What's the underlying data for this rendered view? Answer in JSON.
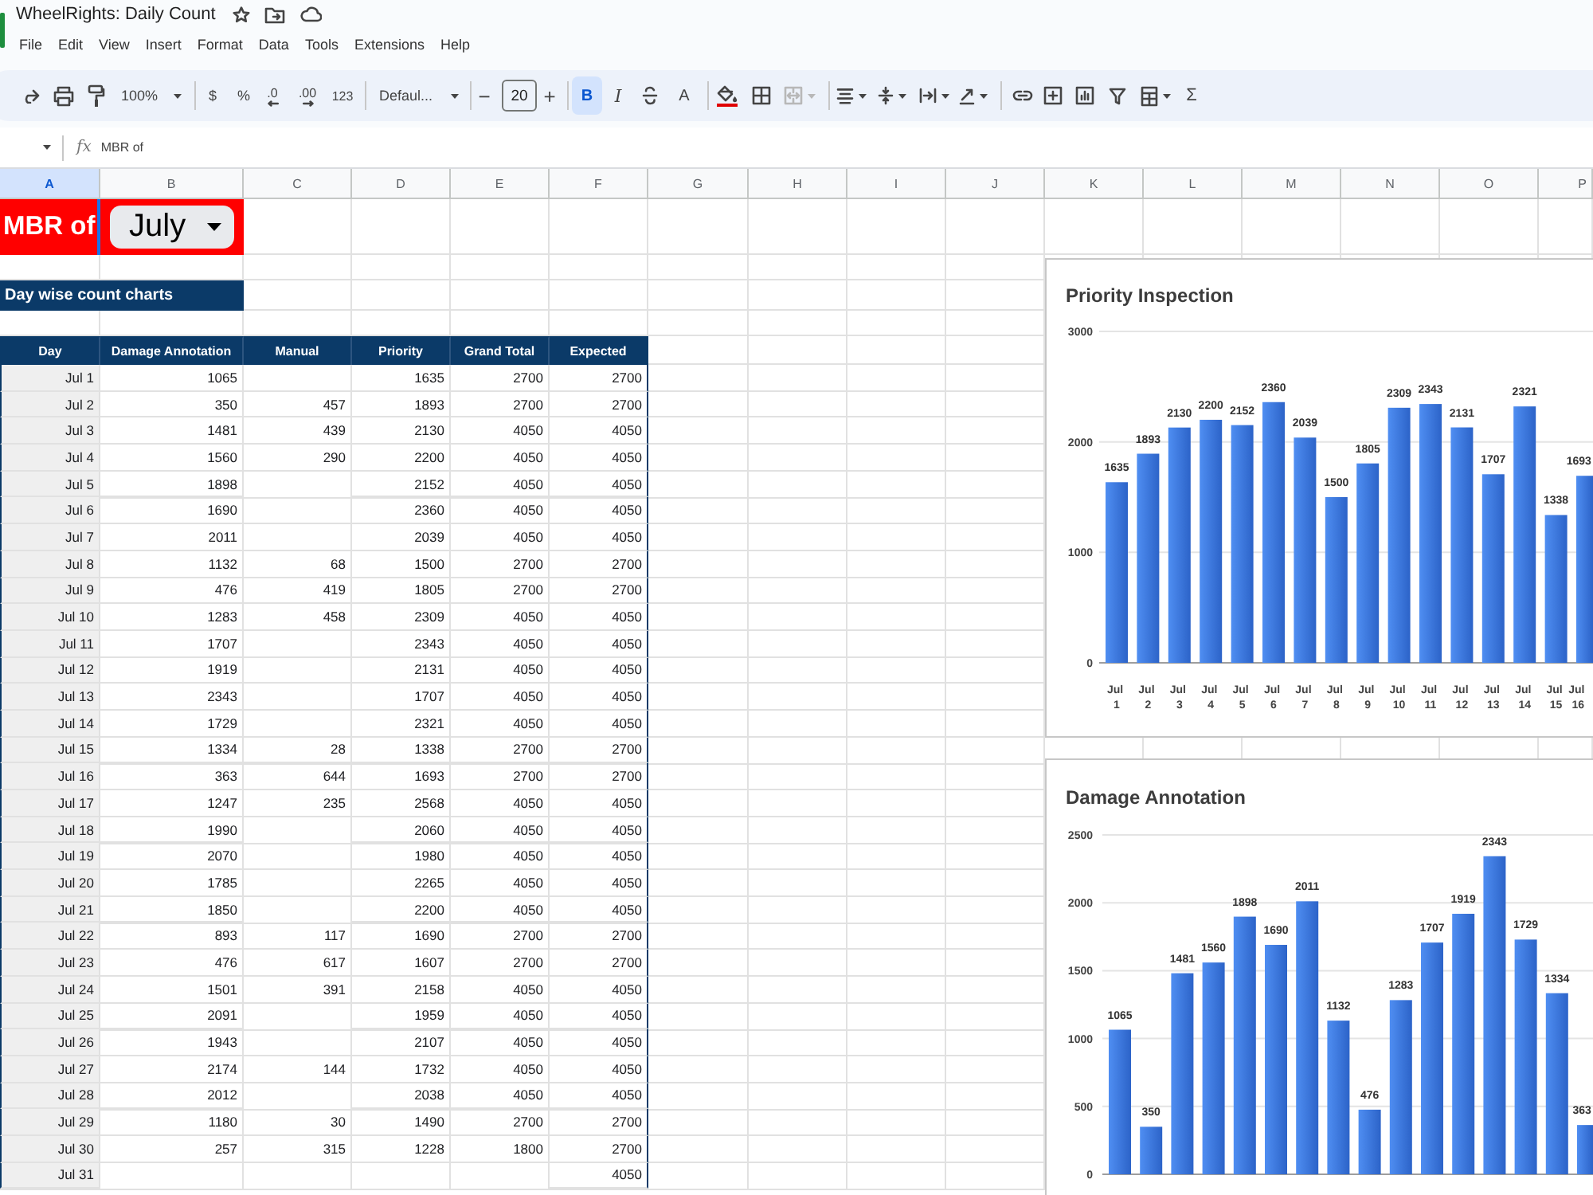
{
  "window": {
    "title": "WheelRights: Daily Count"
  },
  "menu": [
    "File",
    "Edit",
    "View",
    "Insert",
    "Format",
    "Data",
    "Tools",
    "Extensions",
    "Help"
  ],
  "toolbar": {
    "zoom": "100%",
    "currency": "$",
    "percent": "%",
    "decrease_decimal": ".0",
    "increase_decimal": ".00",
    "number_format": "123",
    "font": "Defaul...",
    "size_down": "−",
    "font_size": "20",
    "size_up": "+",
    "bold": {
      "label": "B",
      "on": true
    },
    "italic": "I",
    "text_color": "A",
    "functions": "Σ"
  },
  "formula_bar": {
    "fx": "fx",
    "value": "MBR of"
  },
  "column_headers": [
    {
      "label": "A",
      "selected": true
    },
    {
      "label": "B",
      "selected": false
    },
    {
      "label": "C",
      "selected": false
    },
    {
      "label": "D",
      "selected": false
    },
    {
      "label": "E",
      "selected": false
    },
    {
      "label": "F",
      "selected": false
    },
    {
      "label": "G",
      "selected": false
    },
    {
      "label": "H",
      "selected": false
    },
    {
      "label": "I",
      "selected": false
    },
    {
      "label": "J",
      "selected": false
    },
    {
      "label": "K",
      "selected": false
    },
    {
      "label": "L",
      "selected": false
    },
    {
      "label": "M",
      "selected": false
    },
    {
      "label": "N",
      "selected": false
    },
    {
      "label": "O",
      "selected": false
    },
    {
      "label": "P",
      "selected": false
    }
  ],
  "sheet": {
    "title_cell": {
      "label": "MBR of",
      "selected": true
    },
    "month_dropdown": {
      "value": "July"
    },
    "section_heading": "Day wise count charts",
    "table": {
      "columns": [
        "Day",
        "Damage Annotation",
        "Manual",
        "Priority",
        "Grand Total",
        "Expected"
      ],
      "rows": [
        [
          "Jul 1",
          "1065",
          null,
          "1635",
          "2700",
          "2700"
        ],
        [
          "Jul 2",
          "350",
          "457",
          "1893",
          "2700",
          "2700"
        ],
        [
          "Jul 3",
          "1481",
          "439",
          "2130",
          "4050",
          "4050"
        ],
        [
          "Jul 4",
          "1560",
          "290",
          "2200",
          "4050",
          "4050"
        ],
        [
          "Jul 5",
          "1898",
          null,
          "2152",
          "4050",
          "4050"
        ],
        [
          "Jul 6",
          "1690",
          null,
          "2360",
          "4050",
          "4050"
        ],
        [
          "Jul 7",
          "2011",
          null,
          "2039",
          "4050",
          "4050"
        ],
        [
          "Jul 8",
          "1132",
          "68",
          "1500",
          "2700",
          "2700"
        ],
        [
          "Jul 9",
          "476",
          "419",
          "1805",
          "2700",
          "2700"
        ],
        [
          "Jul 10",
          "1283",
          "458",
          "2309",
          "4050",
          "4050"
        ],
        [
          "Jul 11",
          "1707",
          null,
          "2343",
          "4050",
          "4050"
        ],
        [
          "Jul 12",
          "1919",
          null,
          "2131",
          "4050",
          "4050"
        ],
        [
          "Jul 13",
          "2343",
          null,
          "1707",
          "4050",
          "4050"
        ],
        [
          "Jul 14",
          "1729",
          null,
          "2321",
          "4050",
          "4050"
        ],
        [
          "Jul 15",
          "1334",
          "28",
          "1338",
          "2700",
          "2700"
        ],
        [
          "Jul 16",
          "363",
          "644",
          "1693",
          "2700",
          "2700"
        ],
        [
          "Jul 17",
          "1247",
          "235",
          "2568",
          "4050",
          "4050"
        ],
        [
          "Jul 18",
          "1990",
          null,
          "2060",
          "4050",
          "4050"
        ],
        [
          "Jul 19",
          "2070",
          null,
          "1980",
          "4050",
          "4050"
        ],
        [
          "Jul 20",
          "1785",
          null,
          "2265",
          "4050",
          "4050"
        ],
        [
          "Jul 21",
          "1850",
          null,
          "2200",
          "4050",
          "4050"
        ],
        [
          "Jul 22",
          "893",
          "117",
          "1690",
          "2700",
          "2700"
        ],
        [
          "Jul 23",
          "476",
          "617",
          "1607",
          "2700",
          "2700"
        ],
        [
          "Jul 24",
          "1501",
          "391",
          "2158",
          "4050",
          "4050"
        ],
        [
          "Jul 25",
          "2091",
          null,
          "1959",
          "4050",
          "4050"
        ],
        [
          "Jul 26",
          "1943",
          null,
          "2107",
          "4050",
          "4050"
        ],
        [
          "Jul 27",
          "2174",
          "144",
          "1732",
          "4050",
          "4050"
        ],
        [
          "Jul 28",
          "2012",
          null,
          "2038",
          "4050",
          "4050"
        ],
        [
          "Jul 29",
          "1180",
          "30",
          "1490",
          "2700",
          "2700"
        ],
        [
          "Jul 30",
          "257",
          "315",
          "1228",
          "1800",
          "2700"
        ],
        [
          "Jul 31",
          null,
          null,
          null,
          null,
          "4050"
        ]
      ]
    }
  },
  "charts": [
    {
      "chart_data": {
        "type": "bar",
        "title": "Priority Inspection",
        "categories": [
          "Jul 1",
          "Jul 2",
          "Jul 3",
          "Jul 4",
          "Jul 5",
          "Jul 6",
          "Jul 7",
          "Jul 8",
          "Jul 9",
          "Jul 10",
          "Jul 11",
          "Jul 12",
          "Jul 13",
          "Jul 14",
          "Jul 15",
          "Jul 16"
        ],
        "values": [
          1635,
          1893,
          2130,
          2200,
          2152,
          2360,
          2039,
          1500,
          1805,
          2309,
          2343,
          2131,
          1707,
          2321,
          1338,
          1693
        ],
        "ylim": [
          0,
          3000
        ],
        "yticks": [
          0,
          1000,
          2000,
          3000
        ],
        "grid": true,
        "data_labels": true
      }
    },
    {
      "chart_data": {
        "type": "bar",
        "title": "Damage Annotation",
        "values": [
          1065,
          350,
          1481,
          1560,
          1898,
          1690,
          2011,
          1132,
          476,
          1283,
          1707,
          1919,
          2343,
          1729,
          1334,
          363
        ],
        "ylim": [
          0,
          2500
        ],
        "yticks": [
          0,
          500,
          1000,
          1500,
          2000,
          2500
        ],
        "grid": true,
        "data_labels": true
      }
    }
  ]
}
